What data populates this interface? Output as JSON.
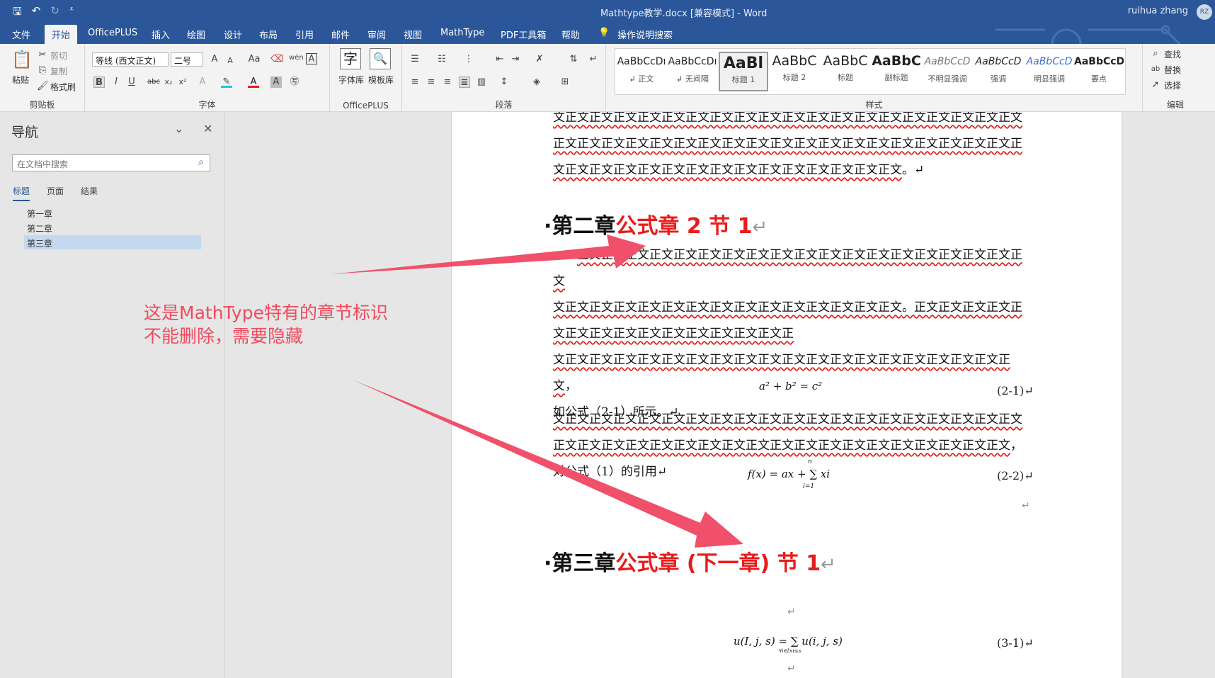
{
  "titlebar": {
    "qat_save": "🖫",
    "qat_undo": "↶",
    "qat_redo": "↻",
    "qat_more": "⩡",
    "doc_title": "Mathtype教学.docx [兼容模式]  -  Word",
    "user": "ruihua zhang",
    "avatar": "RZ"
  },
  "menu": {
    "tabs": [
      "文件",
      "开始",
      "OfficePLUS",
      "插入",
      "绘图",
      "设计",
      "布局",
      "引用",
      "邮件",
      "审阅",
      "视图",
      "MathType",
      "PDF工具箱",
      "帮助"
    ],
    "tell_me": "操作说明搜索"
  },
  "ribbon": {
    "clipboard": {
      "paste": "粘贴",
      "cut": "剪切",
      "copy": "复制",
      "format_painter": "格式刷",
      "label": "剪贴板"
    },
    "font": {
      "font_name": "等线 (西文正文)",
      "font_size": "二号",
      "label": "字体"
    },
    "officeplus": {
      "font_lib": "字体库",
      "template_lib": "模板库",
      "label": "OfficePLUS"
    },
    "paragraph": {
      "label": "段落"
    },
    "styles": {
      "label": "样式",
      "items": [
        {
          "preview": "AaBbCcDı",
          "name": "↲ 正文"
        },
        {
          "preview": "AaBbCcDı",
          "name": "↲ 无间隔"
        },
        {
          "preview": "AaBl",
          "name": "标题 1"
        },
        {
          "preview": "AaBbC",
          "name": "标题 2"
        },
        {
          "preview": "AaBbC",
          "name": "标题"
        },
        {
          "preview": "AaBbC",
          "name": "副标题"
        },
        {
          "preview": "AaBbCcD",
          "name": "不明显强调"
        },
        {
          "preview": "AaBbCcD",
          "name": "强调"
        },
        {
          "preview": "AaBbCcD",
          "name": "明显强调"
        },
        {
          "preview": "AaBbCcD",
          "name": "要点"
        }
      ]
    },
    "editing": {
      "find": "查找",
      "replace": "替换",
      "select": "选择",
      "label": "编辑"
    }
  },
  "nav": {
    "title": "导航",
    "search_placeholder": "在文档中搜索",
    "tabs": [
      "标题",
      "页面",
      "结果"
    ],
    "items": [
      "第一章",
      "第二章",
      "第三章"
    ],
    "selected_index": 2
  },
  "doc": {
    "top_line1": "文正文正文正文正文正文正文正文正文正文正文正文正文正文正文正文正文正文正文正文",
    "top_line2": "正文正文正文正文正文正文正文正文正文正文正文正文正文正文正文正文正文正文正文正",
    "top_line3": "文正文正文正文正文正文正文正文正文正文正文正文正文正文正文",
    "top_line3_end": "。↵",
    "heading2_prefix": "·第二章",
    "heading2_red": "公式章 2 节 1",
    "para1_line1": "正文正文正文正文正文正文正文正文正文正文正文正文正文正文正文正文正文正文正文",
    "para1_line2a": "文正文正文正文正文正文正文正文正文正文正文正文正文正文正文",
    "para1_line2b": "。正文正文正文正文正文正文正文正文正文正文正文正文正文正文正",
    "para1_line3": "文正文正文正文正文正文正文正文正文正文正文正文正文正文正文正文正文正文正文正文",
    "para1_line3_end": "，",
    "para1_line4": "如公式（2-1）所示。↵",
    "eq1": "a² + b² = c²",
    "eq1_no": "(2-1)↵",
    "para2_line1": "文正文正文正文正文正文正文正文正文正文正文正文正文正文正文正文正文正文正文正文",
    "para2_line2": "正文正文正文正文正文正文正文正文正文正文正文正文正文正文正文正文正文正文正文",
    "para2_line2_end": "，对公式（1）的引用↵",
    "eq2": "f(x) = ax + ∑ xi",
    "eq2_sup": "n",
    "eq2_sub": "i=1",
    "eq2_no": "(2-2)↵",
    "empty_mark": "↵",
    "heading3_prefix": "·第三章",
    "heading3_red": "公式章 (下一章) 节 1",
    "heading_mark": "↵",
    "eq3": "u(I, j, s) =  ∑  u(i, j, s)",
    "eq3_sub": "∀i∈I∧i≤s",
    "eq3_no": "(3-1)↵"
  },
  "annotation": {
    "line1": "这是MathType特有的章节标识",
    "line2": "不能删除，需要隐藏",
    "color": "#f04a5e"
  },
  "colors": {
    "accent": "#2b579a",
    "heading_red": "#e81c1c",
    "arrow": "#f0506a"
  }
}
